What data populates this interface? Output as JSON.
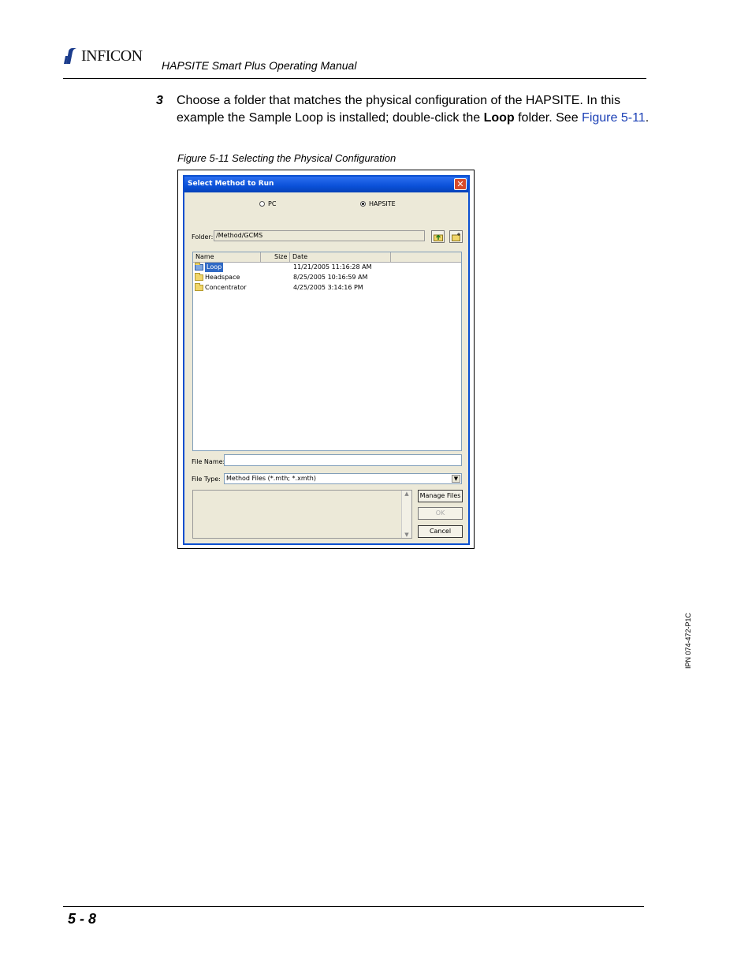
{
  "header": {
    "logo_text": "INFICON",
    "manual_title": "HAPSITE Smart Plus Operating Manual"
  },
  "step": {
    "number": "3",
    "text_1": "Choose a folder that matches the physical configuration of the HAPSITE. In this example the Sample Loop is installed; double-click the ",
    "bold": "Loop",
    "text_2": " folder. See ",
    "link": "Figure 5-11",
    "text_3": "."
  },
  "figure": {
    "caption": "Figure 5-11  Selecting the Physical Configuration"
  },
  "dialog": {
    "title": "Select Method to Run",
    "close_glyph": "✕",
    "radio_pc": "PC",
    "radio_hapsite": "HAPSITE",
    "folder_label": "Folder:",
    "folder_value": "/Method/GCMS",
    "columns": {
      "name": "Name",
      "size": "Size",
      "date": "Date"
    },
    "rows": [
      {
        "name": "Loop",
        "date": "11/21/2005 11:16:28 AM"
      },
      {
        "name": "Headspace",
        "date": "8/25/2005 10:16:59 AM"
      },
      {
        "name": "Concentrator",
        "date": "4/25/2005 3:14:16 PM"
      }
    ],
    "file_name_label": "File Name:",
    "file_name_value": "",
    "file_type_label": "File Type:",
    "file_type_value": "Method Files (*.mth; *.xmth)",
    "buttons": {
      "manage": "Manage Files",
      "ok": "OK",
      "cancel": "Cancel"
    }
  },
  "side": {
    "ipn": "IPN 074-472-P1C"
  },
  "footer": {
    "page_number": "5 - 8"
  }
}
